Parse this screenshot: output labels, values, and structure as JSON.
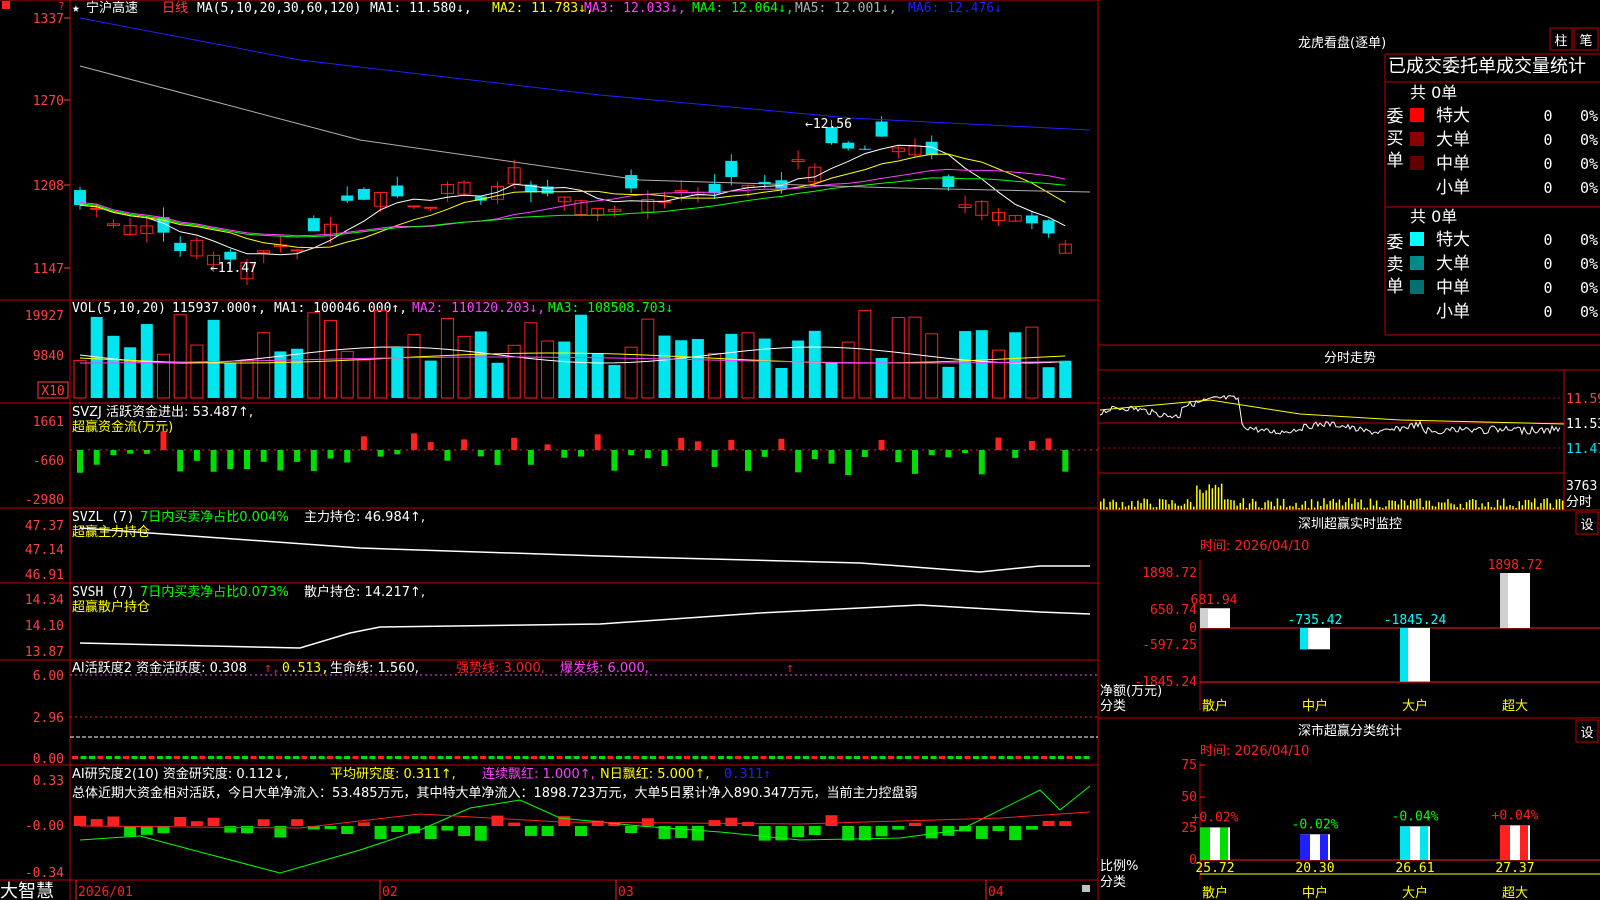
{
  "colors": {
    "up": "#ff2020",
    "down": "#00e5ee",
    "border": "#c00000",
    "axis": "#ff4040",
    "ma1": "#ffffff",
    "ma2": "#ffff00",
    "ma3": "#ff40ff",
    "ma4": "#00ff00",
    "ma5": "#b0b0b0",
    "ma6": "#2020ff",
    "green_bar": "#00dd00"
  },
  "corner_mark": "?",
  "header": {
    "star": "★",
    "stock": "宁沪高速",
    "period": "日线",
    "ma_label": "MA(5,10,20,30,60,120)",
    "ma1": "MA1: 11.580↓,",
    "ma2": "MA2: 11.783↓,",
    "ma3": "MA3: 12.033↓,",
    "ma4": "MA4: 12.064↓,",
    "ma5": "MA5: 12.001↓,",
    "ma6": "MA6: 12.476↓"
  },
  "price_axis": [
    "1337",
    "1270",
    "1208",
    "1147"
  ],
  "annotations": {
    "high": "←12.56",
    "low": "←11.47"
  },
  "vol": {
    "label": "VOL(5,10,20)",
    "val": "115937.000↑,",
    "ma1": "MA1: 100046.000↑,",
    "ma2": "MA2: 110120.203↓,",
    "ma3": "MA3: 108508.703↓",
    "axis": [
      "19927",
      "9840"
    ],
    "unit": "X10"
  },
  "svzj": {
    "label": "SVZJ  活跃资金进出: 53.487↑,",
    "sub": "超赢资金流(万元)",
    "axis": [
      "1661",
      "-660",
      "-2980"
    ]
  },
  "svzl": {
    "a": "SVZL (7)",
    "b": "7日内买卖净占比0.004%",
    "c": "主力持仓: 46.984↑,",
    "sub": "超赢主力持仓",
    "axis": [
      "47.37",
      "47.14",
      "46.91"
    ]
  },
  "svsh": {
    "a": "SVSH (7)",
    "b": "7日内买卖净占比0.073%",
    "c": "散户持仓: 14.217↑,",
    "sub": "超赢散户持仓",
    "axis": [
      "14.34",
      "14.10",
      "13.87"
    ]
  },
  "ai2": {
    "a": "AI活跃度2 资金活跃度: 0.308",
    "b": "↑,",
    "c": "0.513,",
    "d": "生命线: 1.560,",
    "e": "强势线: 3.000,",
    "f": "爆发线: 6.000,",
    "g": "↑",
    "axis": [
      "6.00",
      "2.96",
      "0.00"
    ]
  },
  "ai_res": {
    "a": "AI研究度2(10) 资金研究度: 0.112↓,",
    "b": "平均研究度: 0.311↑,",
    "c": "连续飘红: 1.000↑,",
    "d": "N日飘红: 5.000↑,",
    "e": "0.311↑",
    "text": "总体近期大资金相对活跃，今日大单净流入：53.485万元，其中特大单净流入：1898.723万元，大单5日累计净入890.347万元，当前主力控盘弱",
    "axis": [
      "0.33",
      "-0.00",
      "-0.34"
    ]
  },
  "dates": [
    "2026/01",
    "02",
    "03",
    "04"
  ],
  "brand": "大智慧",
  "lhkp": {
    "title": "龙虎看盘(逐单)",
    "btn1": "柱",
    "btn2": "笔",
    "subtitle": "已成交委托单成交量统计",
    "buy_side": "委买单",
    "sell_side": "委卖单",
    "total_buy": "共 0单",
    "total_sell": "共 0单",
    "buy_rows": [
      {
        "label": "特大",
        "val": "0",
        "pct": "0%"
      },
      {
        "label": "大单",
        "val": "0",
        "pct": "0%"
      },
      {
        "label": "中单",
        "val": "0",
        "pct": "0%"
      },
      {
        "label": "小单",
        "val": "0",
        "pct": "0%"
      }
    ],
    "sell_rows": [
      {
        "label": "特大",
        "val": "0",
        "pct": "0%"
      },
      {
        "label": "大单",
        "val": "0",
        "pct": "0%"
      },
      {
        "label": "中单",
        "val": "0",
        "pct": "0%"
      },
      {
        "label": "小单",
        "val": "0",
        "pct": "0%"
      }
    ]
  },
  "intraday": {
    "title": "分时走势",
    "axis": [
      "11.59",
      "11.53",
      "11.47"
    ],
    "vol": "3763",
    "unit": "分时"
  },
  "sz_monitor": {
    "title": "深圳超赢实时监控",
    "btn": "设",
    "time": "时间: 2026/04/10",
    "axis": [
      "1898.72",
      "650.74",
      "0",
      "-597.25",
      "-1845.24"
    ],
    "ylabel": "净额(万元)",
    "xlabel": "分类",
    "cats": [
      "散户",
      "中户",
      "大户",
      "超大"
    ],
    "values": [
      681.94,
      -735.42,
      -1845.24,
      1898.72
    ],
    "labels": [
      "681.94",
      "-735.42",
      "-1845.24",
      "1898.72"
    ]
  },
  "sz_class": {
    "title": "深市超赢分类统计",
    "btn": "设",
    "time": "时间: 2026/04/10",
    "axis": [
      "75",
      "50",
      "25",
      "0"
    ],
    "ylabel": "比例%",
    "xlabel": "分类",
    "cats": [
      "散户",
      "中户",
      "大户",
      "超大"
    ],
    "values": [
      25.72,
      20.3,
      26.61,
      27.37
    ],
    "labels": [
      "25.72",
      "20.30",
      "26.61",
      "27.37"
    ],
    "changes": [
      "+0.02%",
      "-0.02%",
      "-0.04%",
      "+0.04%"
    ]
  },
  "chart_data": [
    {
      "type": "candlestick",
      "title": "宁沪高速 日线",
      "series": [
        {
          "name": "MA1",
          "last": 11.58
        },
        {
          "name": "MA2",
          "last": 11.783
        },
        {
          "name": "MA3",
          "last": 12.033
        },
        {
          "name": "MA4",
          "last": 12.064
        },
        {
          "name": "MA5",
          "last": 12.001
        },
        {
          "name": "MA6",
          "last": 12.476
        }
      ],
      "ylim": [
        11.47,
        13.37
      ],
      "annotations": [
        "12.56",
        "11.47"
      ]
    },
    {
      "type": "bar",
      "title": "VOL(5,10,20)",
      "last": 115937.0,
      "ma": [
        100046.0,
        110120.203,
        108508.703
      ],
      "ylim": [
        0,
        19927
      ]
    },
    {
      "type": "bar",
      "title": "超赢资金流(万元)",
      "last": 53.487,
      "ylim": [
        -2980,
        1661
      ]
    },
    {
      "type": "line",
      "title": "超赢主力持仓",
      "last": 46.984,
      "ylim": [
        46.91,
        47.37
      ]
    },
    {
      "type": "line",
      "title": "超赢散户持仓",
      "last": 14.217,
      "ylim": [
        13.87,
        14.34
      ]
    },
    {
      "type": "bar",
      "title": "深圳超赢实时监控",
      "categories": [
        "散户",
        "中户",
        "大户",
        "超大"
      ],
      "values": [
        681.94,
        -735.42,
        -1845.24,
        1898.72
      ],
      "ylabel": "净额(万元)",
      "xlabel": "分类"
    },
    {
      "type": "bar",
      "title": "深市超赢分类统计",
      "categories": [
        "散户",
        "中户",
        "大户",
        "超大"
      ],
      "values": [
        25.72,
        20.3,
        26.61,
        27.37
      ],
      "ylabel": "比例%",
      "xlabel": "分类",
      "ylim": [
        0,
        75
      ]
    }
  ]
}
